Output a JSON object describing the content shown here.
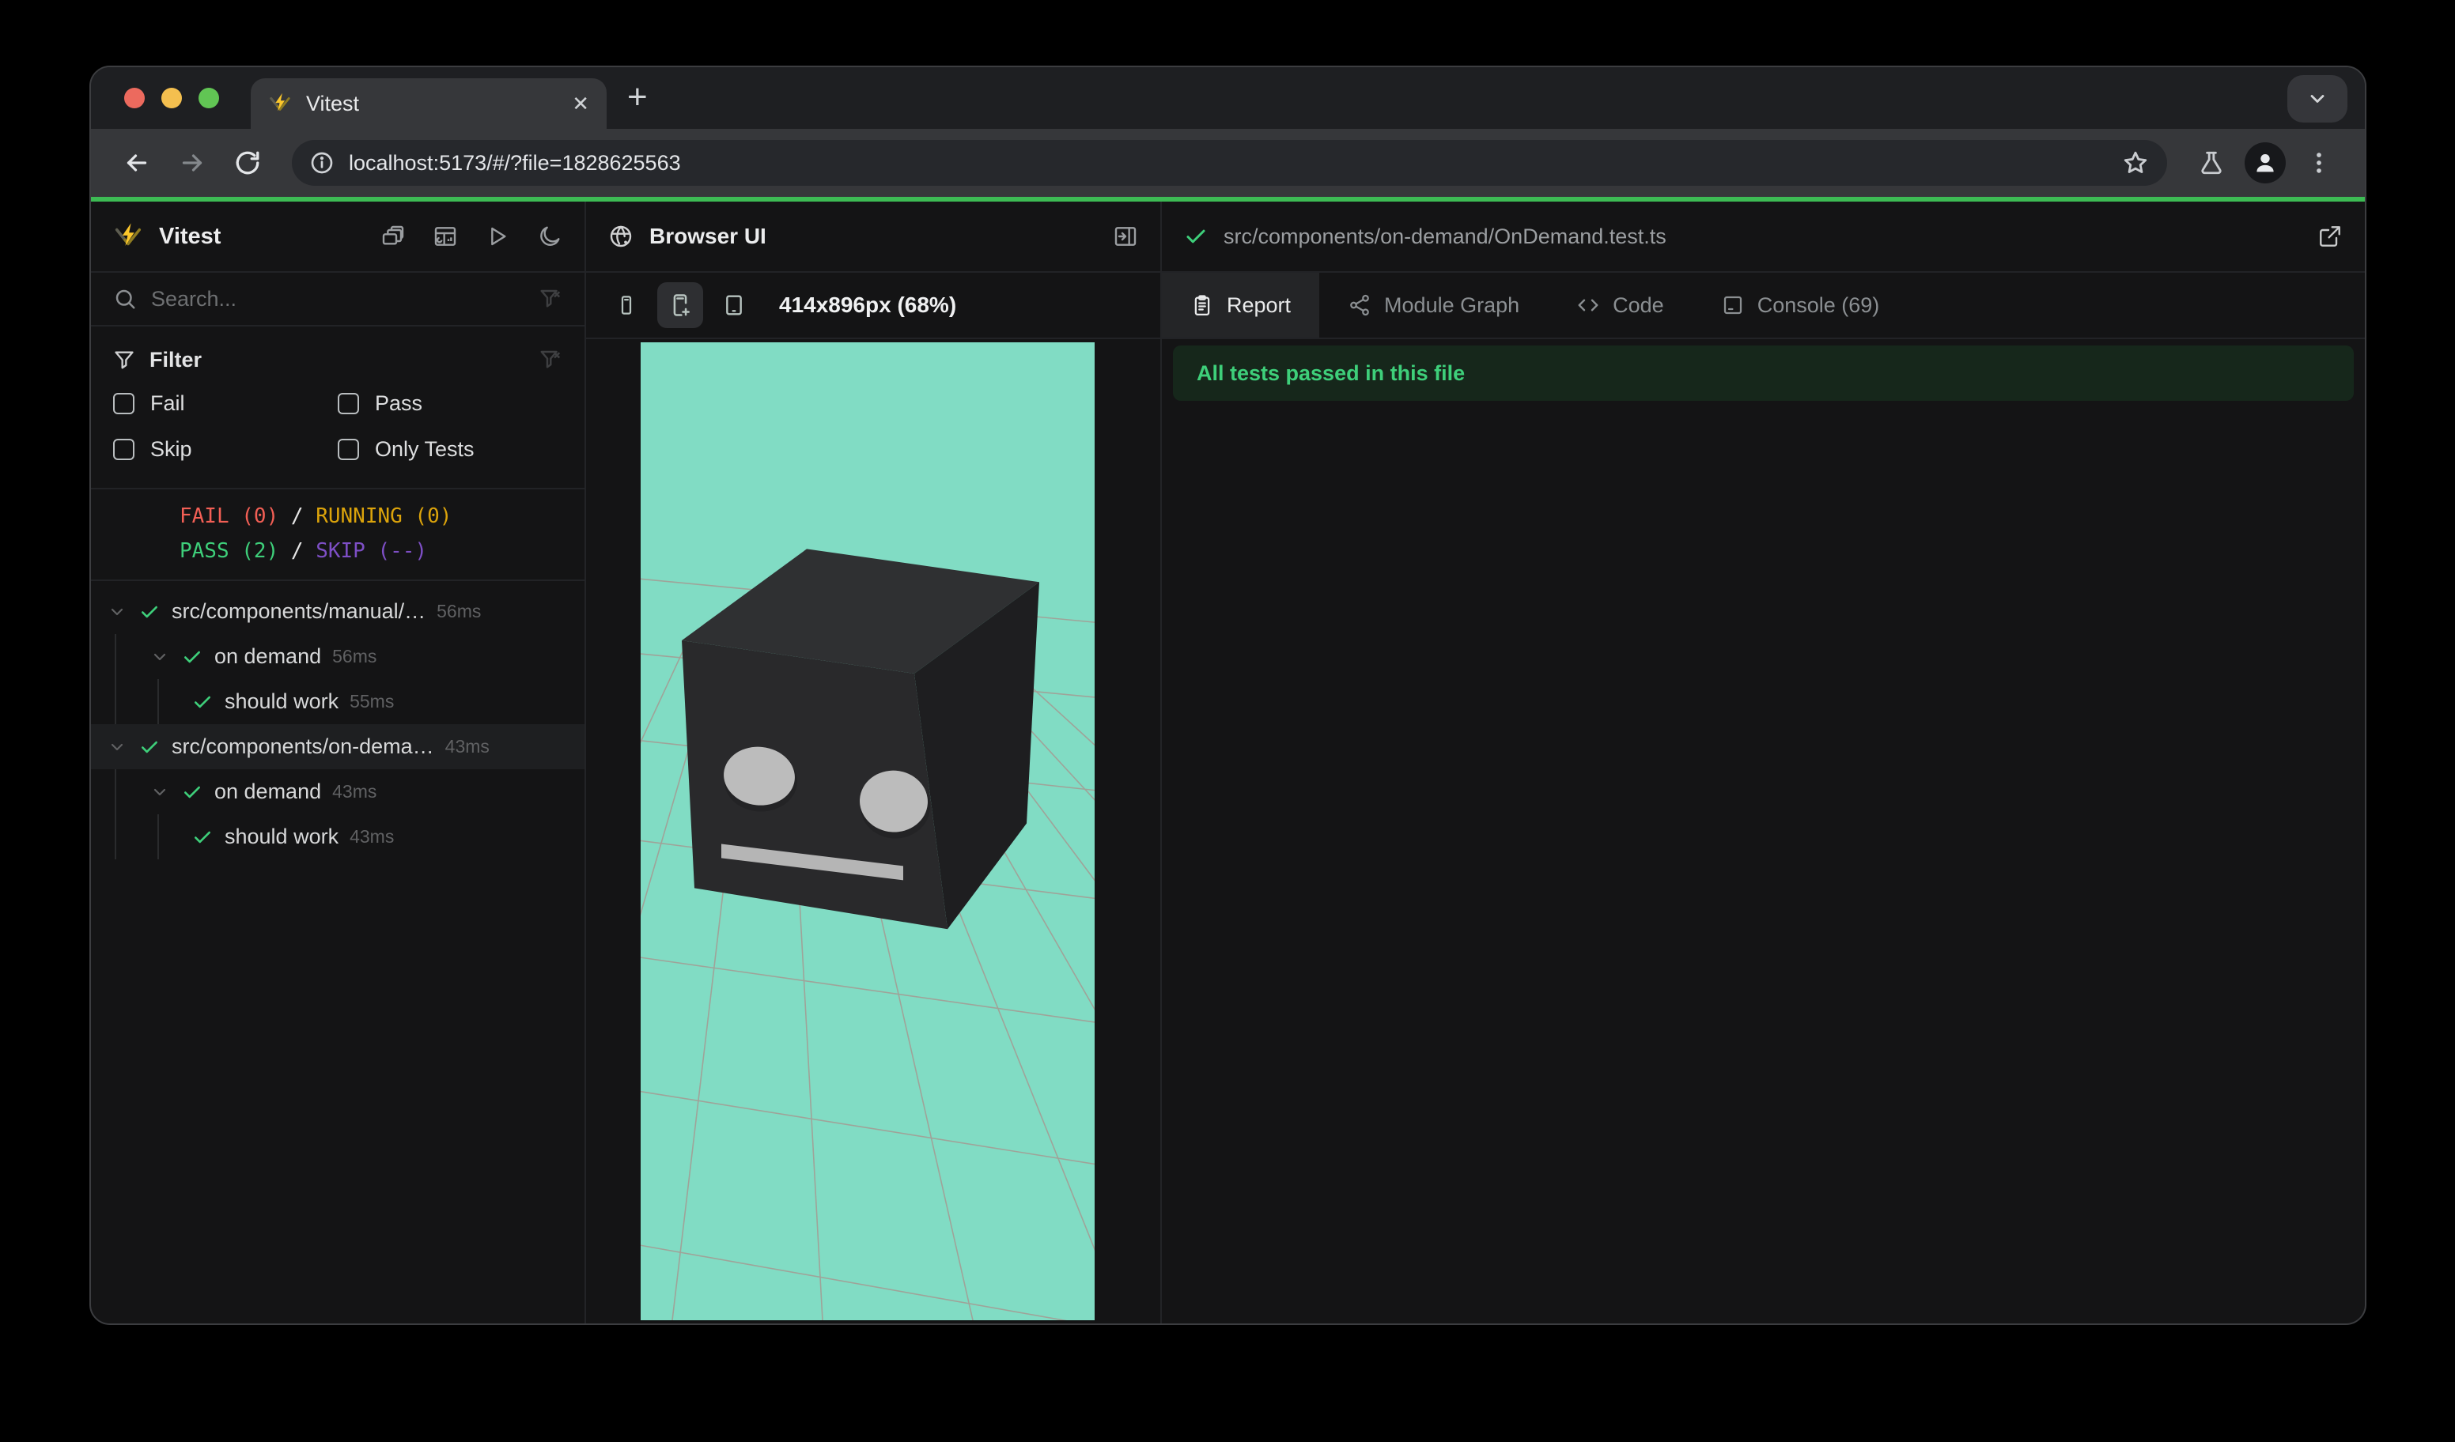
{
  "browser": {
    "tab_title": "Vitest",
    "url": "localhost:5173/#/?file=1828625563",
    "toolbar_icons": [
      "back-arrow",
      "forward-arrow",
      "reload",
      "site-info",
      "bookmark-star",
      "experiments-flask",
      "profile-avatar",
      "overflow-menu"
    ],
    "tabstrip_icons": [
      "favicon-vitest",
      "close-tab",
      "new-tab",
      "tab-search-chevron"
    ]
  },
  "sidebar": {
    "app_title": "Vitest",
    "header_actions": [
      "windows-stack",
      "dashboard",
      "run-all",
      "toggle-dark-mode"
    ],
    "search_placeholder": "Search...",
    "filter": {
      "title": "Filter",
      "options": [
        "Fail",
        "Pass",
        "Skip",
        "Only Tests"
      ]
    },
    "status": {
      "fail": "FAIL (0)",
      "running": "RUNNING (0)",
      "pass": "PASS (2)",
      "skip": "SKIP (--)",
      "separator": "/"
    },
    "tree": {
      "rows": [
        {
          "kind": "file",
          "level": 0,
          "chevron": true,
          "name": "src/components/manual/…",
          "time": "56ms",
          "selected": false
        },
        {
          "kind": "suite",
          "level": 1,
          "chevron": true,
          "name": "on demand",
          "time": "56ms",
          "selected": false
        },
        {
          "kind": "test",
          "level": 2,
          "chevron": false,
          "name": "should work",
          "time": "55ms",
          "selected": false
        },
        {
          "kind": "file",
          "level": 0,
          "chevron": true,
          "name": "src/components/on-dema…",
          "time": "43ms",
          "selected": true
        },
        {
          "kind": "suite",
          "level": 1,
          "chevron": true,
          "name": "on demand",
          "time": "43ms",
          "selected": false
        },
        {
          "kind": "test",
          "level": 2,
          "chevron": false,
          "name": "should work",
          "time": "43ms",
          "selected": false
        }
      ]
    }
  },
  "browser_panel": {
    "title": "Browser UI",
    "viewport_label": "414x896px (68%)",
    "device_buttons": [
      "phone-small",
      "phone-plus",
      "tablet"
    ]
  },
  "report_panel": {
    "file_path": "src/components/on-demand/OnDemand.test.ts",
    "tabs": [
      {
        "label": "Report",
        "icon": "report",
        "active": true
      },
      {
        "label": "Module Graph",
        "icon": "module-graph",
        "active": false
      },
      {
        "label": "Code",
        "icon": "code",
        "active": false
      },
      {
        "label": "Console (69)",
        "icon": "console",
        "active": false
      }
    ],
    "banner": "All tests passed in this file"
  },
  "colors": {
    "progress_green": "#3dbb54",
    "pass_green": "#3ecf7a",
    "fail_red": "#f25f55",
    "running_yellow": "#dba30b",
    "skip_purple": "#7e4fc6",
    "viewport_mint": "#81dcc4",
    "banner_bg": "#16271b",
    "logo_yellow": "#fcc72b"
  }
}
